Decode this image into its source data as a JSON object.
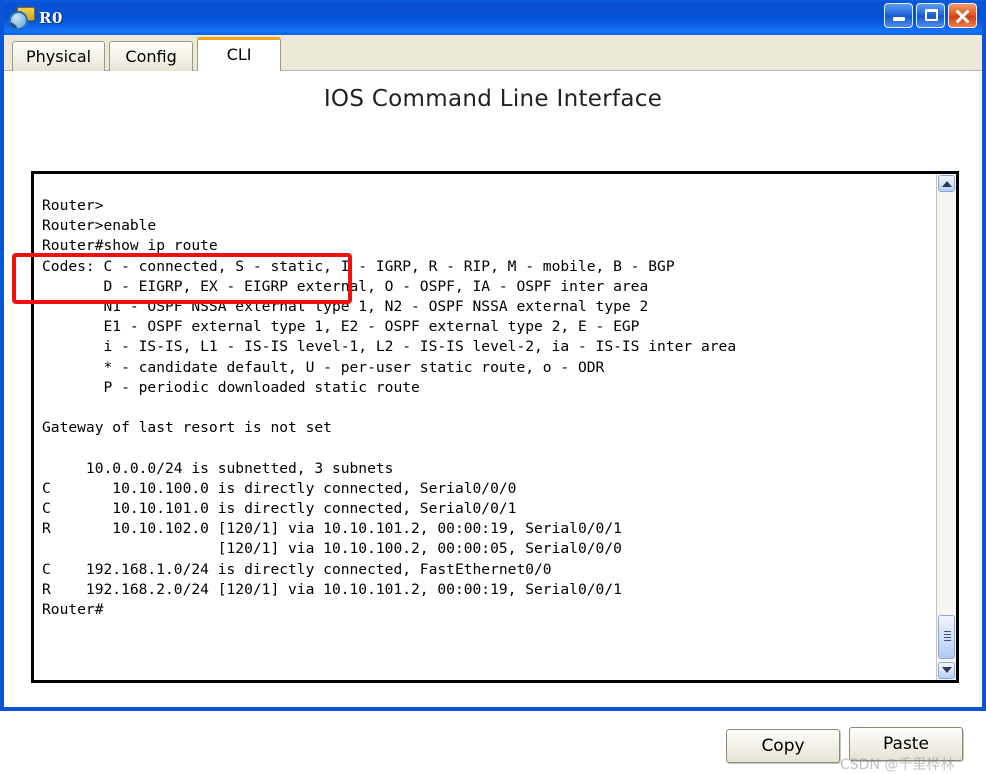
{
  "window": {
    "title": "R0",
    "icon": "inspect-router-icon",
    "buttons": {
      "minimize": "minimize",
      "maximize": "maximize",
      "close": "close"
    },
    "accent_blue": "#0a53d6",
    "tab_accent_orange": "#f5a216"
  },
  "tabs": [
    {
      "label": "Physical",
      "active": false
    },
    {
      "label": "Config",
      "active": false
    },
    {
      "label": "CLI",
      "active": true
    }
  ],
  "panel": {
    "title": "IOS Command Line Interface"
  },
  "terminal": {
    "text": "Router>\nRouter>enable\nRouter#show ip route\nCodes: C - connected, S - static, I - IGRP, R - RIP, M - mobile, B - BGP\n       D - EIGRP, EX - EIGRP external, O - OSPF, IA - OSPF inter area\n       N1 - OSPF NSSA external type 1, N2 - OSPF NSSA external type 2\n       E1 - OSPF external type 1, E2 - OSPF external type 2, E - EGP\n       i - IS-IS, L1 - IS-IS level-1, L2 - IS-IS level-2, ia - IS-IS inter area\n       * - candidate default, U - per-user static route, o - ODR\n       P - periodic downloaded static route\n\nGateway of last resort is not set\n\n     10.0.0.0/24 is subnetted, 3 subnets\nC       10.10.100.0 is directly connected, Serial0/0/0\nC       10.10.101.0 is directly connected, Serial0/0/1\nR       10.10.102.0 [120/1] via 10.10.101.2, 00:00:19, Serial0/0/1\n                    [120/1] via 10.10.100.2, 00:00:05, Serial0/0/0\nC    192.168.1.0/24 is directly connected, FastEthernet0/0\nR    192.168.2.0/24 [120/1] via 10.10.101.2, 00:00:19, Serial0/0/1\nRouter#",
    "scrollbar": {
      "up_arrow": "scroll-up",
      "down_arrow": "scroll-down",
      "thumb_position": "bottom"
    }
  },
  "annotation": {
    "color": "#f01010",
    "highlighted_lines": "Router>enable / Router#show ip route"
  },
  "actions": {
    "copy_label": "Copy",
    "paste_label": "Paste"
  },
  "watermark": {
    "text": "CSDN @千里桦林"
  }
}
